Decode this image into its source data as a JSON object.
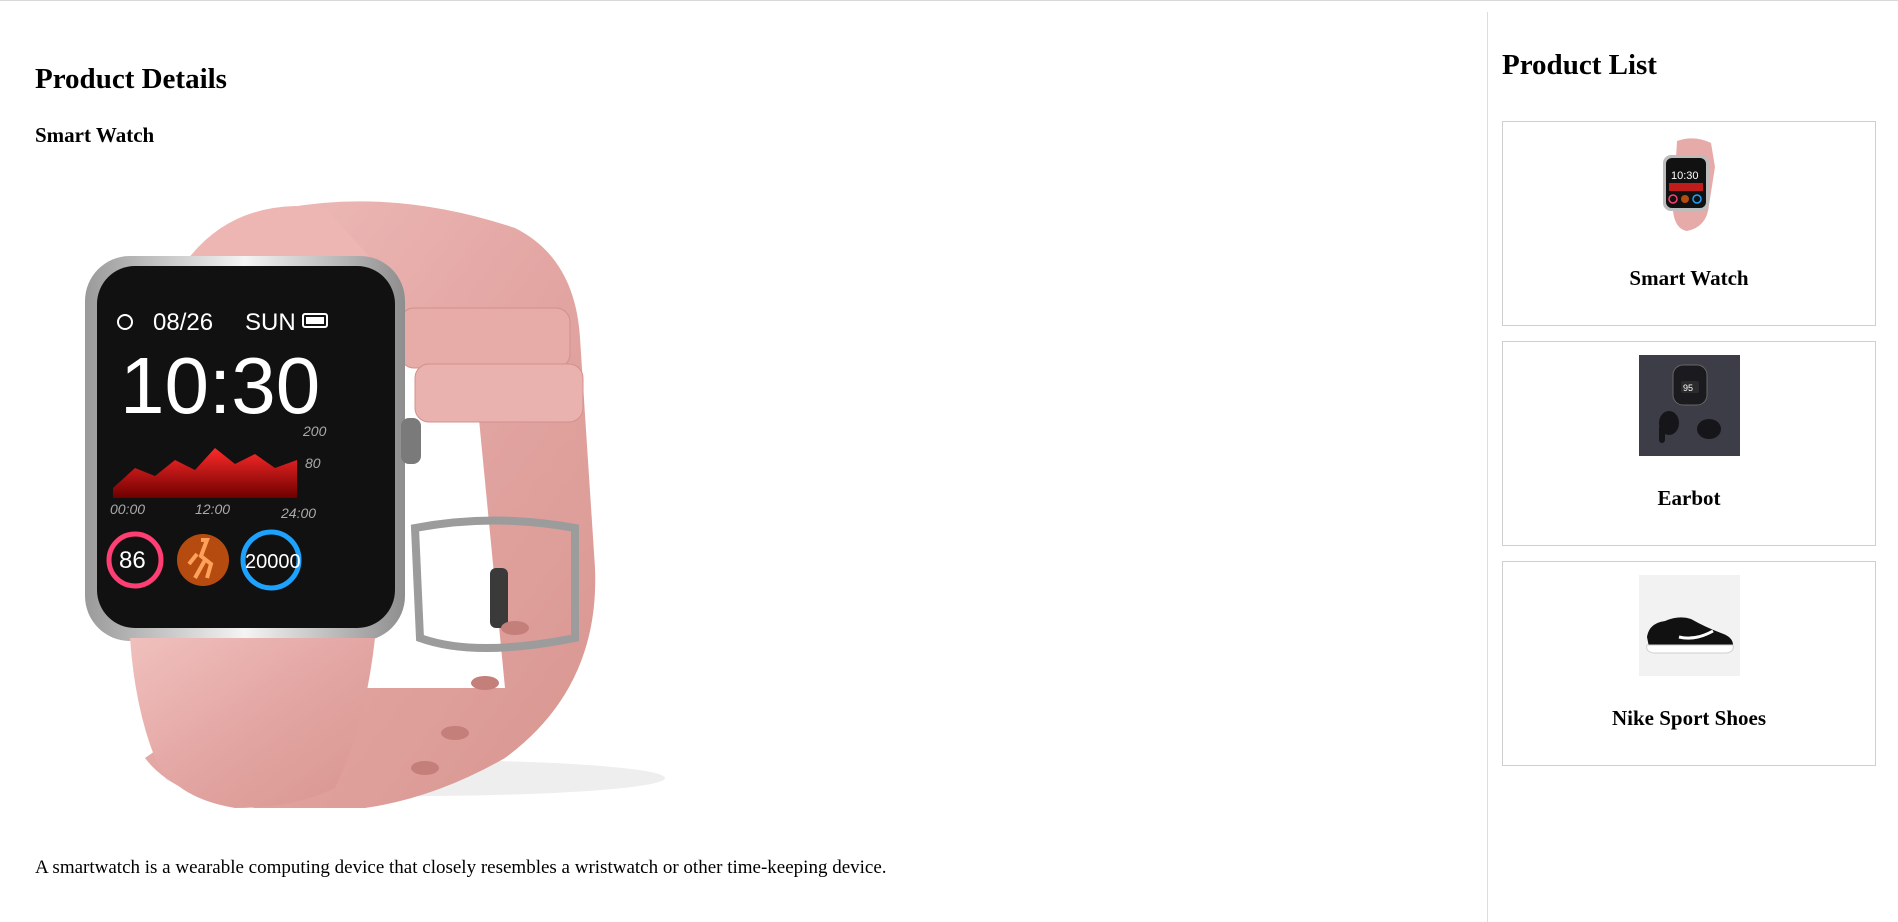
{
  "main": {
    "title": "Product Details",
    "product": {
      "name": "Smart Watch",
      "image_icon": "smartwatch-image",
      "screen": {
        "date": "08/26",
        "day": "SUN",
        "time": "10:30",
        "scale_high": "200",
        "scale_low": "80",
        "axis_times": [
          "00:00",
          "12:00",
          "24:00"
        ],
        "heart_rate": "86",
        "steps": "20000"
      },
      "band_color": "#e6aaa8",
      "description": "A smartwatch is a wearable computing device that closely resembles a wristwatch or other time-keeping device."
    }
  },
  "sidebar": {
    "title": "Product List",
    "items": [
      {
        "label": "Smart Watch",
        "icon": "smartwatch-thumbnail"
      },
      {
        "label": "Earbot",
        "icon": "earbuds-thumbnail",
        "thumb_text": "95"
      },
      {
        "label": "Nike Sport Shoes",
        "icon": "sneaker-thumbnail"
      }
    ]
  }
}
